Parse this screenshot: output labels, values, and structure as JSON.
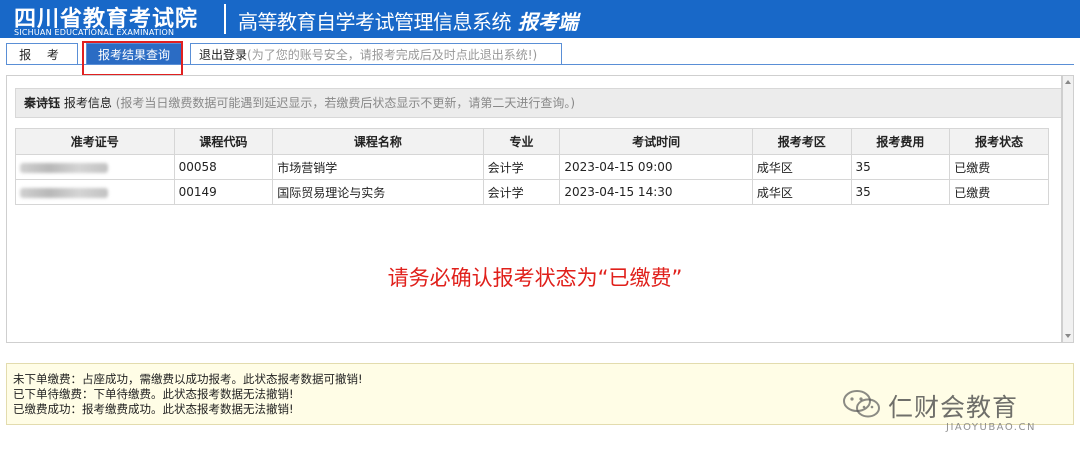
{
  "header": {
    "org_name": "四川省教育考试院",
    "org_name_en": "SICHUAN EDUCATIONAL EXAMINATION",
    "system_name": "高等教育自学考试管理信息系统",
    "system_tag": "报考端",
    "bg_color": "#1868c8"
  },
  "tabs": {
    "baokao": "报 考",
    "result": "报考结果查询",
    "logout": "退出登录",
    "logout_note": "(为了您的账号安全，请报考完成后及时点此退出系统!)"
  },
  "info_bar": {
    "name": "秦诗钰",
    "label": "报考信息",
    "note": "(报考当日缴费数据可能遇到延迟显示，若缴费后状态显示不更新，请第二天进行查询。)"
  },
  "table": {
    "columns": [
      "准考证号",
      "课程代码",
      "课程名称",
      "专业",
      "考试时间",
      "报考考区",
      "报考费用",
      "报考状态"
    ],
    "rows": [
      {
        "course_code": "00058",
        "course_name": "市场营销学",
        "major": "会计学",
        "exam_time": "2023-04-15 09:00",
        "district": "成华区",
        "fee": "35",
        "status": "已缴费"
      },
      {
        "course_code": "00149",
        "course_name": "国际贸易理论与实务",
        "major": "会计学",
        "exam_time": "2023-04-15 14:30",
        "district": "成华区",
        "fee": "35",
        "status": "已缴费"
      }
    ]
  },
  "annotation": {
    "text": "请务必确认报考状态为“已缴费”",
    "color": "#e0201b"
  },
  "legend": [
    "未下单缴费：占座成功，需缴费以成功报考。此状态报考数据可撤销!",
    "已下单待缴费：下单待缴费。此状态报考数据无法撤销!",
    "已缴费成功：报考缴费成功。此状态报考数据无法撤销!"
  ],
  "watermark": {
    "text": "仁财会教育",
    "url": "JIAOYUBAO.CN",
    "icon": "wechat-icon"
  }
}
